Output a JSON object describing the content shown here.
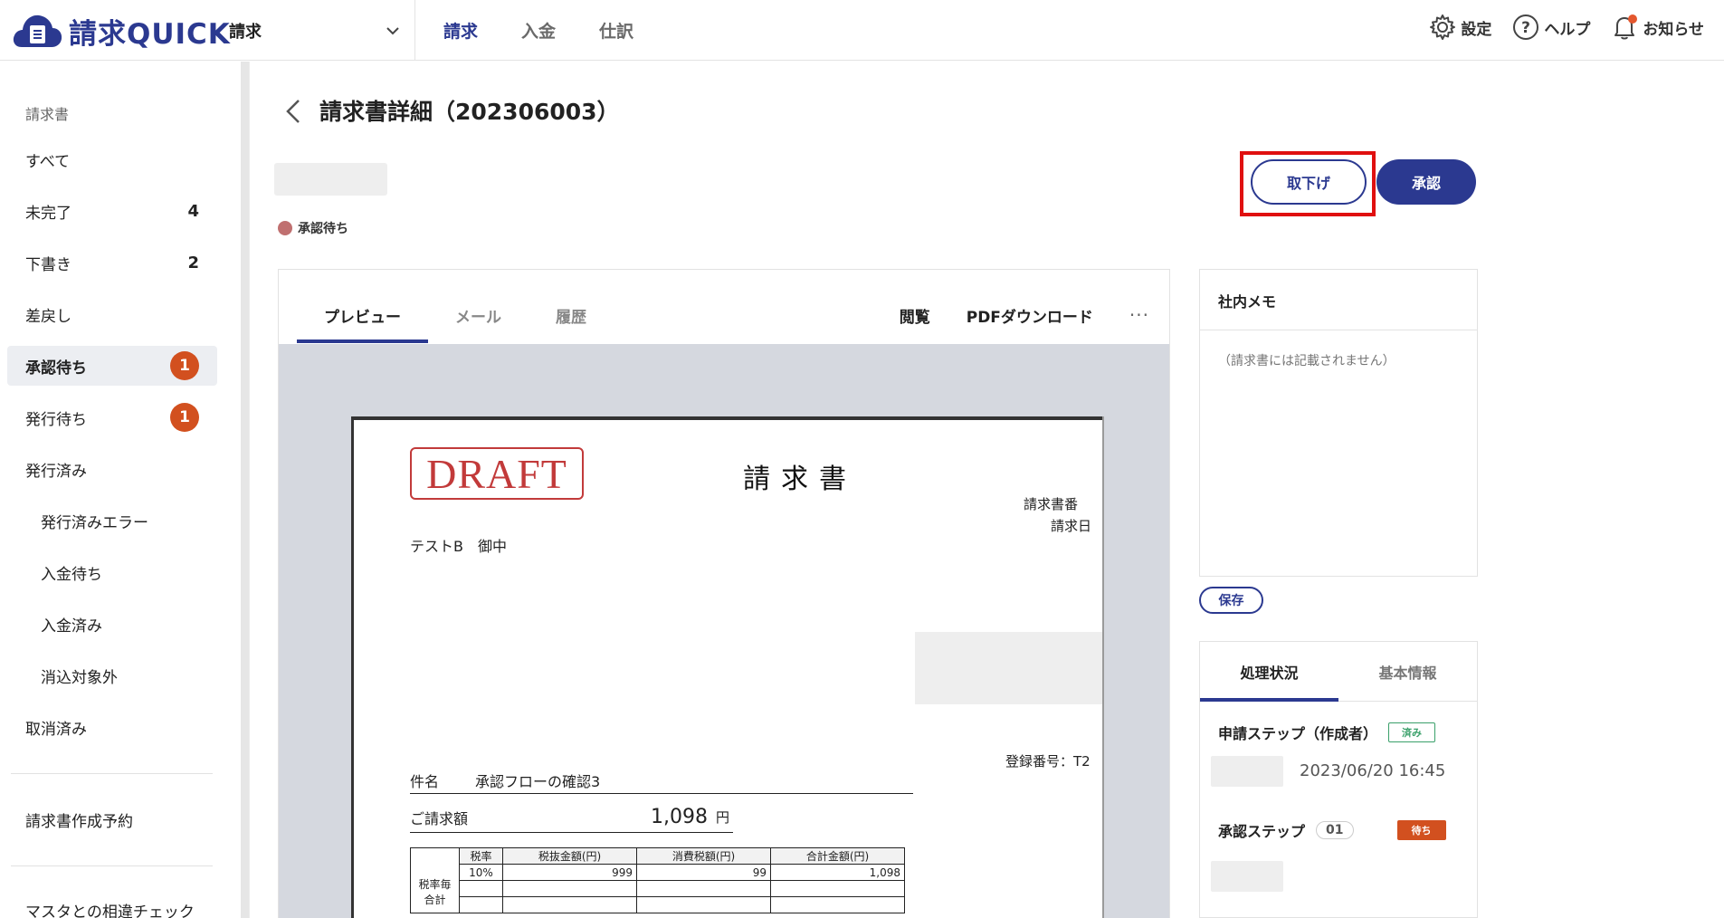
{
  "header": {
    "logo_text": "請求QUICK",
    "module_select": "請求",
    "nav": [
      "請求",
      "入金",
      "仕訳"
    ],
    "settings": "設定",
    "help": "ヘルプ",
    "notifications": "お知らせ"
  },
  "sidebar": {
    "heading": "請求書",
    "items": [
      {
        "label": "すべて",
        "count": ""
      },
      {
        "label": "未完了",
        "count": "4"
      },
      {
        "label": "下書き",
        "count": "2"
      },
      {
        "label": "差戻し",
        "count": ""
      },
      {
        "label": "承認待ち",
        "badge": "1"
      },
      {
        "label": "発行待ち",
        "badge": "1"
      },
      {
        "label": "発行済み",
        "count": ""
      },
      {
        "label": "発行済みエラー",
        "count": ""
      },
      {
        "label": "入金待ち",
        "count": ""
      },
      {
        "label": "入金済み",
        "count": ""
      },
      {
        "label": "消込対象外",
        "count": ""
      },
      {
        "label": "取消済み",
        "count": ""
      }
    ],
    "schedule": "請求書作成予約",
    "master_check": "マスタとの相違チェック"
  },
  "page": {
    "title": "請求書詳細（202306003）",
    "status": "承認待ち",
    "withdraw_button": "取下げ",
    "approve_button": "承認"
  },
  "preview": {
    "tabs": [
      "プレビュー",
      "メール",
      "履歴"
    ],
    "actions": {
      "view": "閲覧",
      "pdf": "PDFダウンロード",
      "more": "···"
    }
  },
  "invoice": {
    "draft": "DRAFT",
    "title": "請求書",
    "number_label": "請求書番",
    "date_label": "請求日",
    "customer": "テストB　御中",
    "registration": "登録番号：T2",
    "subject_label": "件名",
    "subject": "承認フローの確認3",
    "amount_label": "ご請求額",
    "amount": "1,098",
    "yen": "円",
    "table": {
      "headers": [
        "税率",
        "税抜金額(円)",
        "消費税額(円)",
        "合計金額(円)"
      ],
      "row_label": "税率毎合計",
      "rows": [
        [
          "10%",
          "999",
          "99",
          "1,098"
        ]
      ]
    }
  },
  "memo": {
    "title": "社内メモ",
    "placeholder": "（請求書には記載されません）",
    "save_button": "保存"
  },
  "status_panel": {
    "tabs": [
      "処理状況",
      "基本情報"
    ],
    "step1": {
      "label": "申請ステップ（作成者）",
      "tag": "済み",
      "date": "2023/06/20 16:45"
    },
    "step2": {
      "label": "承認ステップ",
      "num": "01",
      "tag": "待ち"
    }
  },
  "colors": {
    "brand": "#2b3990",
    "badge": "#d2501f",
    "highlight": "#e01010",
    "draft": "#c23a3a"
  }
}
